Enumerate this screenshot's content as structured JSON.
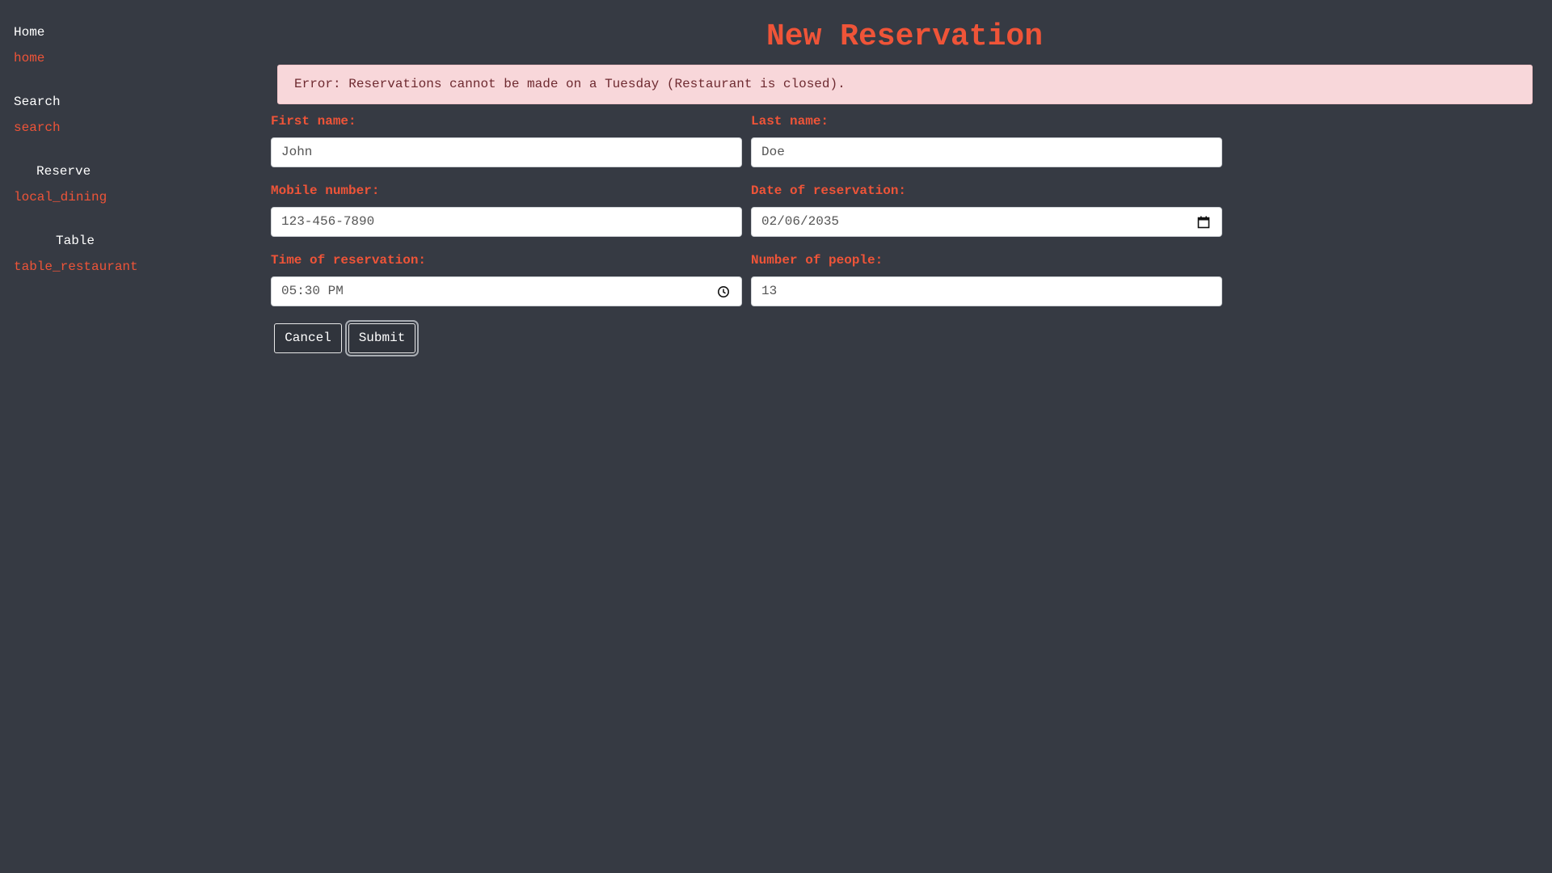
{
  "sidebar": {
    "items": [
      {
        "label": "Home",
        "icon": "home"
      },
      {
        "label": "Search",
        "icon": "search"
      },
      {
        "label": "Reserve",
        "icon": "local_dining"
      },
      {
        "label": "Table",
        "icon": "table_restaurant"
      }
    ]
  },
  "page": {
    "title": "New Reservation",
    "error": "Error: Reservations cannot be made on a Tuesday (Restaurant is closed)."
  },
  "form": {
    "first_name": {
      "label": "First name:",
      "value": "John"
    },
    "last_name": {
      "label": "Last name:",
      "value": "Doe"
    },
    "mobile": {
      "label": "Mobile number:",
      "value": "123-456-7890"
    },
    "date": {
      "label": "Date of reservation:",
      "value": "02/06/2035"
    },
    "time": {
      "label": "Time of reservation:",
      "value": "05:30 PM"
    },
    "people": {
      "label": "Number of people:",
      "value": "13"
    }
  },
  "buttons": {
    "cancel": "Cancel",
    "submit": "Submit"
  },
  "colors": {
    "background": "#363a43",
    "accent": "#ef5438",
    "error_bg": "#f8d7da"
  }
}
